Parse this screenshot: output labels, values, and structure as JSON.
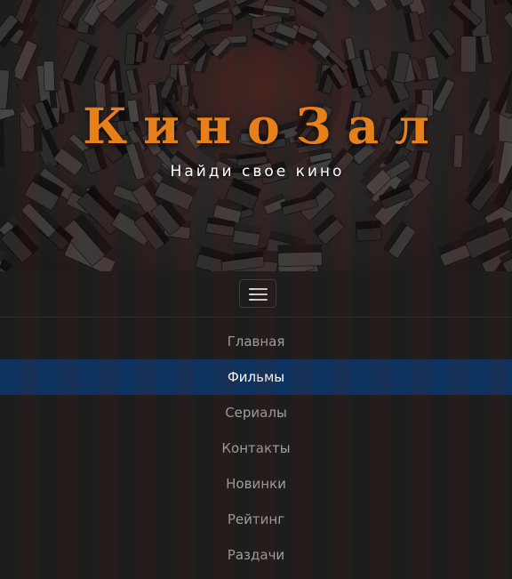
{
  "header": {
    "brand": "КиноЗал",
    "tagline": "Найди свое кино",
    "background_image": "dark-3d-cubes-vortex-image"
  },
  "navbar": {
    "toggle_icon": "hamburger-menu-icon",
    "items": [
      {
        "label": "Главная",
        "active": false
      },
      {
        "label": "Фильмы",
        "active": true
      },
      {
        "label": "Сериалы",
        "active": false
      },
      {
        "label": "Контакты",
        "active": false
      },
      {
        "label": "Новинки",
        "active": false
      },
      {
        "label": "Рейтинг",
        "active": false
      },
      {
        "label": "Раздачи",
        "active": false
      }
    ]
  },
  "colors": {
    "brand": "#e8801a",
    "active_item_bg": "#0d3360",
    "nav_bg": "#1d1d1d",
    "nav_text": "#a0a0a0"
  }
}
